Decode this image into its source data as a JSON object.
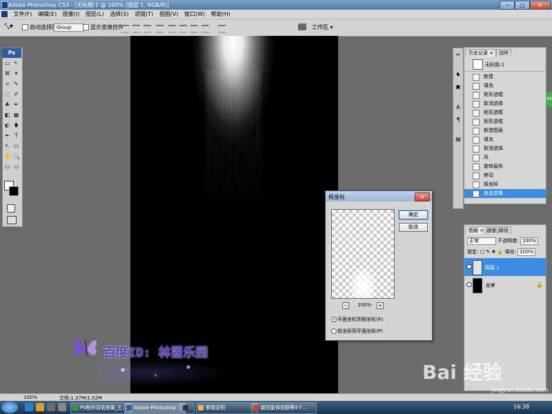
{
  "window": {
    "title": "Adobe Photoshop CS3 - [无标题-1 @ 100% (图层 1, RGB/8)]",
    "min": "−",
    "restore": "□",
    "close": "×"
  },
  "menu": [
    "文件(F)",
    "编辑(E)",
    "图像(I)",
    "图层(L)",
    "选择(S)",
    "滤镜(T)",
    "视图(V)",
    "窗口(W)",
    "帮助(H)"
  ],
  "options": {
    "auto_select_label": "自动选择图层",
    "auto_select_value": "Group",
    "show_transform_label": "显示变换控件",
    "workspace_label": "工作区 ▾"
  },
  "toolbox": {
    "logo": "Ps",
    "tools": [
      "▭",
      "↖",
      "⌘",
      "✦",
      "⌗",
      "✎",
      "◌",
      "✐",
      "♣",
      "✒",
      "◧",
      "▦",
      "◐",
      "⬮",
      "✒",
      "T",
      "↖",
      "▭",
      "✋",
      "🔍",
      "▭",
      "▭"
    ]
  },
  "canvas": {
    "watermark": "百度ID: 林曌乐园"
  },
  "dialog": {
    "title": "极坐标",
    "close": "×",
    "ok": "确定",
    "cancel": "取消",
    "zoom_minus": "−",
    "zoom_plus": "+",
    "zoom": "100%",
    "option1": "平面坐标到极坐标(R)",
    "option2": "极坐标到平面坐标(P)",
    "selected_option": "option1"
  },
  "dock": [
    "✂",
    "♞",
    "▣",
    "A",
    "¶",
    "▤"
  ],
  "history": {
    "tabs": [
      "历史记录 ×",
      "动作"
    ],
    "snapshot": "无标题-1",
    "items": [
      "新建",
      "填充",
      "矩形选框",
      "取消选择",
      "矩形选框",
      "矩形选框",
      "新建图层",
      "填充",
      "取消选择",
      "风",
      "旋转画布",
      "移动",
      "极坐标",
      "自由变换"
    ],
    "selected_index": 13
  },
  "layers": {
    "tabs": [
      "图层 ×",
      "通道",
      "路径"
    ],
    "blend_mode": "正常",
    "opacity_label": "不透明度:",
    "opacity": "100%",
    "lock_label": "锁定:",
    "fill_label": "填充:",
    "fill": "100%",
    "items": [
      {
        "name": "图层 1",
        "selected": true
      },
      {
        "name": "背景",
        "selected": false
      }
    ]
  },
  "status": {
    "zoom": "100%",
    "doc": "文档:1.37M/1.02M"
  },
  "taskbar": {
    "buttons": [
      "PS制作羽毛效果_土...",
      "Adobe Photoshop ...",
      "",
      "参观证明",
      "新回复体验群等4个..."
    ],
    "clock": "16:38"
  },
  "brand": {
    "baidu": "Bai 经验",
    "url": "jingyan.baidu.com",
    "green_tab": "64"
  },
  "colors": {
    "accent": "#3a8de0",
    "canvas": "#000000",
    "watermark": "#5b3ac0"
  }
}
